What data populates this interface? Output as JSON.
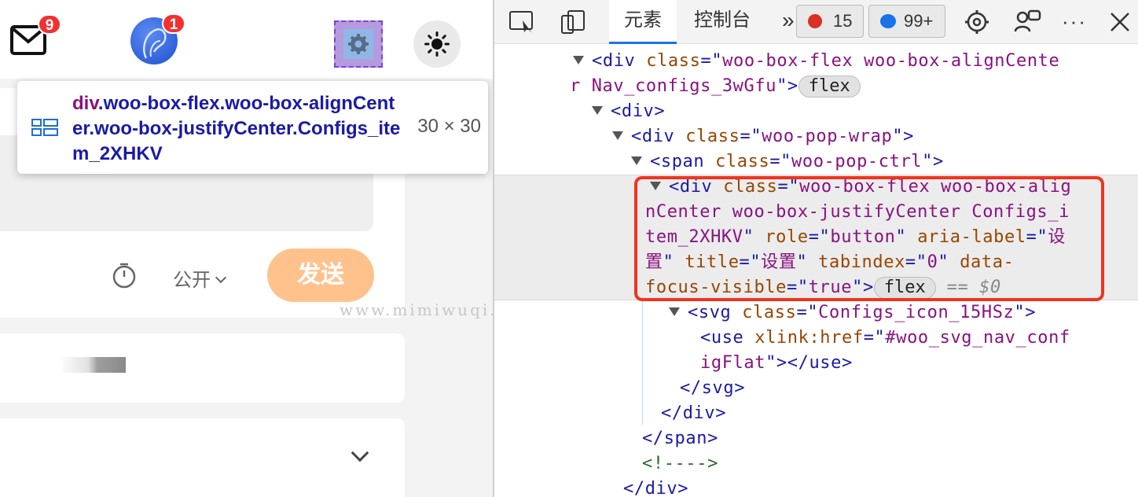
{
  "page": {
    "mail_badge": "9",
    "avatar_badge": "1",
    "tooltip": {
      "tag_name": "div",
      "tag_rest": ".woo-box-flex.woo-box-alignCenter.woo-box-justifyCenter.Configs_item_2XHKV",
      "size": "30 × 30"
    },
    "visibility_label": "公开",
    "send_button": "发送",
    "watermark": "www.mimiwuqi.com"
  },
  "devtools": {
    "tabs": {
      "elements": "元素",
      "console": "控制台",
      "more": "»"
    },
    "error_count": "15",
    "message_count": "99+",
    "lines": {
      "l1_a": "<div ",
      "l1_b": "class",
      "l1_c": "=\"",
      "l1_d": "woo-box-flex woo-box-alignCente",
      "l2_a": "r Nav_configs_3wGfu",
      "l2_b": "\">",
      "l2_badge": "flex",
      "l3": "<div>",
      "l4_a": "<div ",
      "l4_b": "class",
      "l4_c": "=\"",
      "l4_d": "woo-pop-wrap",
      "l4_e": "\">",
      "l5_a": "<span ",
      "l5_b": "class",
      "l5_c": "=\"",
      "l5_d": "woo-pop-ctrl",
      "l5_e": "\">",
      "l6_a": "<div ",
      "l6_b": "class",
      "l6_c": "=\"",
      "l6_d": "woo-box-flex woo-box-alig",
      "l7": "nCenter woo-box-justifyCenter Configs_i",
      "l8_a": "tem_2XHKV",
      "l8_b": "\" ",
      "l8_c": "role",
      "l8_d": "=\"",
      "l8_e": "button",
      "l8_f": "\" ",
      "l8_g": "aria-label",
      "l8_h": "=\"",
      "l8_i": "设",
      "l9_a": "置",
      "l9_b": "\" ",
      "l9_c": "title",
      "l9_d": "=\"",
      "l9_e": "设置",
      "l9_f": "\" ",
      "l9_g": "tabindex",
      "l9_h": "=\"",
      "l9_i": "0",
      "l9_j": "\" ",
      "l9_k": "data-",
      "l10_a": "focus-visible",
      "l10_b": "=\"",
      "l10_c": "true",
      "l10_d": "\">",
      "l10_badge": "flex",
      "l10_e": " == $0",
      "l11_a": "<svg ",
      "l11_b": "class",
      "l11_c": "=\"",
      "l11_d": "Configs_icon_15HSz",
      "l11_e": "\">",
      "l12_a": "<use ",
      "l12_b": "xlink:href",
      "l12_c": "=\"",
      "l12_d": "#woo_svg_nav_conf",
      "l13_a": "igFlat",
      "l13_b": "\"></use>",
      "l14": "</svg>",
      "l15": "</div>",
      "l16": "</span>",
      "l17": "<!---->",
      "l18": "</div>"
    }
  }
}
